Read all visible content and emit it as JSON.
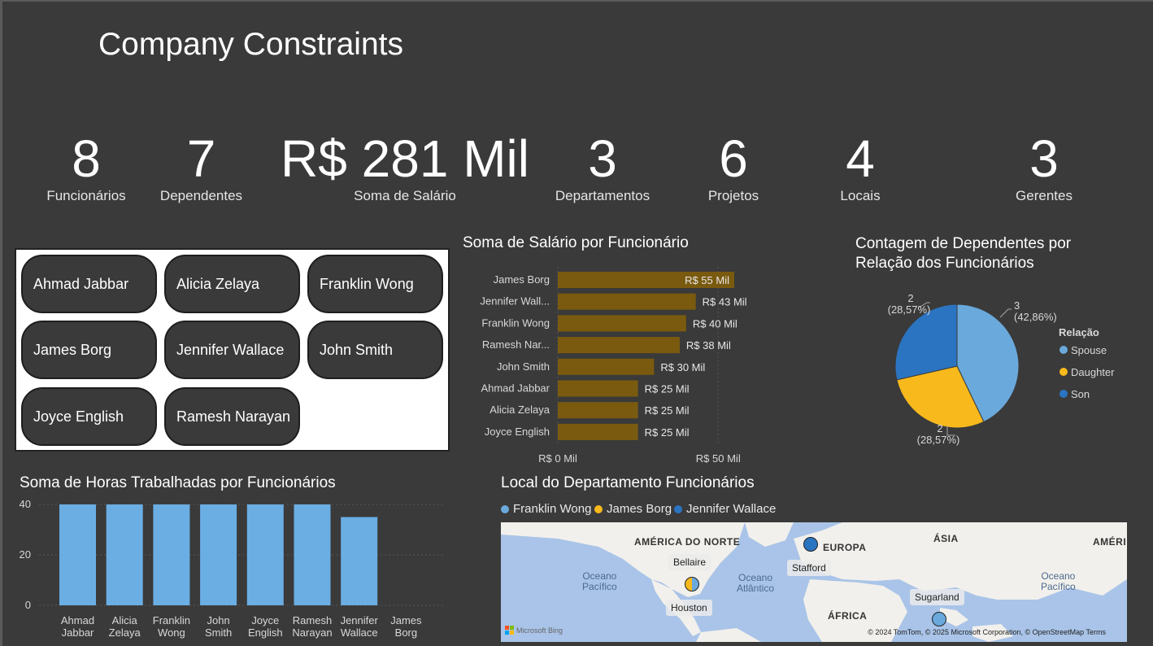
{
  "title": "Company Constraints",
  "kpis": [
    {
      "value": "8",
      "label": "Funcionários"
    },
    {
      "value": "7",
      "label": "Dependentes"
    },
    {
      "value": "R$ 281 Mil",
      "label": "Soma de Salário"
    },
    {
      "value": "3",
      "label": "Departamentos"
    },
    {
      "value": "6",
      "label": "Projetos"
    },
    {
      "value": "4",
      "label": "Locais"
    },
    {
      "value": "3",
      "label": "Gerentes"
    }
  ],
  "slicer": {
    "items": [
      "Ahmad Jabbar",
      "Alicia Zelaya",
      "Franklin Wong",
      "James Borg",
      "Jennifer Wallace",
      "John Smith",
      "Joyce English",
      "Ramesh Narayan"
    ]
  },
  "salary_chart_title": "Soma de Salário por Funcionário",
  "dependents_chart_title": "Contagem de Dependentes por Relação dos Funcionários",
  "hours_chart_title": "Soma de Horas Trabalhadas por Funcionários",
  "map_title": "Local do Departamento Funcionários",
  "chart_data": [
    {
      "type": "bar",
      "orientation": "horizontal",
      "title": "Soma de Salário por Funcionário",
      "categories": [
        "James Borg",
        "Jennifer Wall...",
        "Franklin Wong",
        "Ramesh Nar...",
        "John Smith",
        "Ahmad Jabbar",
        "Alicia Zelaya",
        "Joyce English"
      ],
      "values": [
        55,
        43,
        40,
        38,
        30,
        25,
        25,
        25
      ],
      "data_labels": [
        "R$ 55 Mil",
        "R$ 43 Mil",
        "R$ 40 Mil",
        "R$ 38 Mil",
        "R$ 30 Mil",
        "R$ 25 Mil",
        "R$ 25 Mil",
        "R$ 25 Mil"
      ],
      "xticks": [
        "R$ 0 Mil",
        "R$ 50 Mil"
      ],
      "xlim": [
        0,
        55
      ],
      "color": "#7a5a0f"
    },
    {
      "type": "pie",
      "title": "Contagem de Dependentes por Relação dos Funcionários",
      "legend_title": "Relação",
      "slices": [
        {
          "name": "Spouse",
          "value": 3,
          "label": "3",
          "pct": "(42,86%)",
          "color": "#6aa9dc"
        },
        {
          "name": "Daughter",
          "value": 2,
          "label": "2",
          "pct": "(28,57%)",
          "color": "#f8b91c"
        },
        {
          "name": "Son",
          "value": 2,
          "label": "2",
          "pct": "(28,57%)",
          "color": "#2b74c1"
        }
      ]
    },
    {
      "type": "bar",
      "title": "Soma de Horas Trabalhadas por Funcionários",
      "categories": [
        [
          "Ahmad",
          "Jabbar"
        ],
        [
          "Alicia",
          "Zelaya"
        ],
        [
          "Franklin",
          "Wong"
        ],
        [
          "John",
          "Smith"
        ],
        [
          "Joyce",
          "English"
        ],
        [
          "Ramesh",
          "Narayan"
        ],
        [
          "Jennifer",
          "Wallace"
        ],
        [
          "James",
          "Borg"
        ]
      ],
      "values": [
        40,
        40,
        40,
        40,
        40,
        40,
        35,
        0
      ],
      "yticks": [
        "40",
        "20",
        "0"
      ],
      "ylim": [
        0,
        40
      ],
      "color": "#6aaee4"
    }
  ],
  "map": {
    "legend": [
      {
        "name": "Franklin Wong",
        "color": "#6aa9dc"
      },
      {
        "name": "James Borg",
        "color": "#f8b91c"
      },
      {
        "name": "Jennifer Wallace",
        "color": "#2b74c1"
      }
    ],
    "regions": [
      "AMÉRICA DO NORTE",
      "EUROPA",
      "ÁSIA",
      "AMÉRI",
      "ÁFRICA"
    ],
    "oceans": [
      [
        "Oceano",
        "Pacífico"
      ],
      [
        "Oceano",
        "Atlântico"
      ],
      [
        "Oceano",
        "Pacífico"
      ]
    ],
    "cities": [
      "Bellaire",
      "Houston",
      "Stafford",
      "Sugarland"
    ],
    "credits": "© 2024 TomTom, © 2025 Microsoft Corporation, © OpenStreetMap  Terms",
    "brand": "Microsoft Bing"
  }
}
